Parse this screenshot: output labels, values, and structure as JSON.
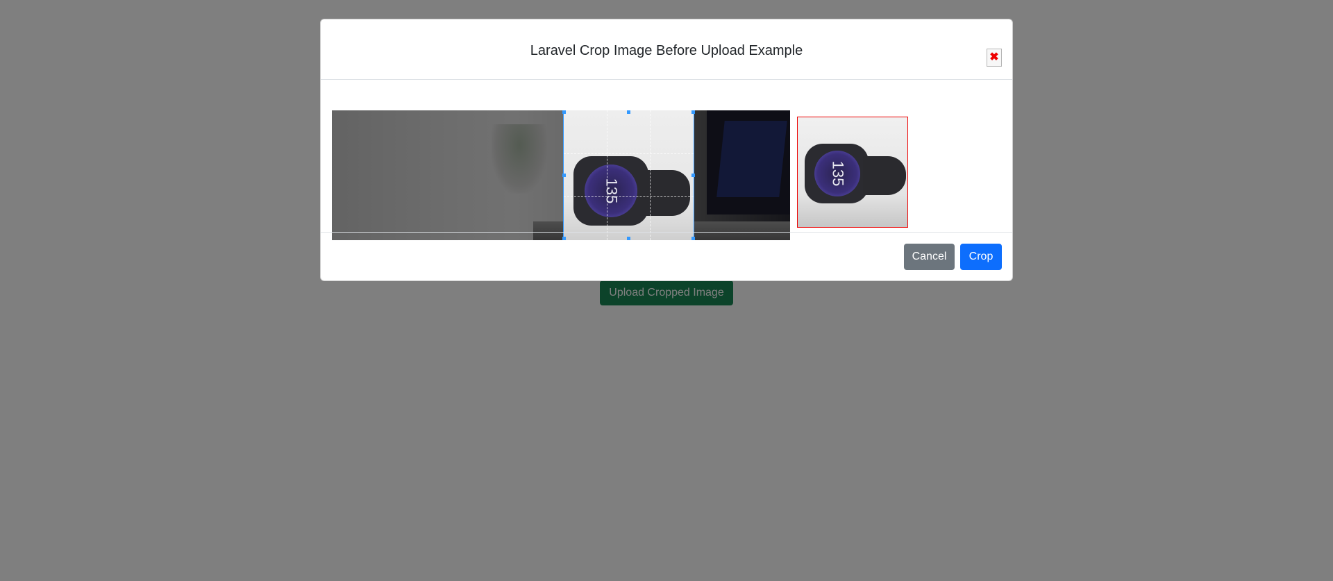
{
  "page": {
    "upload_button_label": "Upload Cropped Image"
  },
  "modal": {
    "title": "Laravel Crop Image Before Upload Example",
    "close_icon_glyph": "✖",
    "cropper": {
      "watch_reading": "135"
    },
    "footer": {
      "cancel_label": "Cancel",
      "crop_label": "Crop"
    }
  },
  "colors": {
    "primary": "#0d6efd",
    "secondary": "#6c757d",
    "success": "#198754",
    "crop_outline": "#3399ff",
    "preview_border": "#ee0000"
  }
}
